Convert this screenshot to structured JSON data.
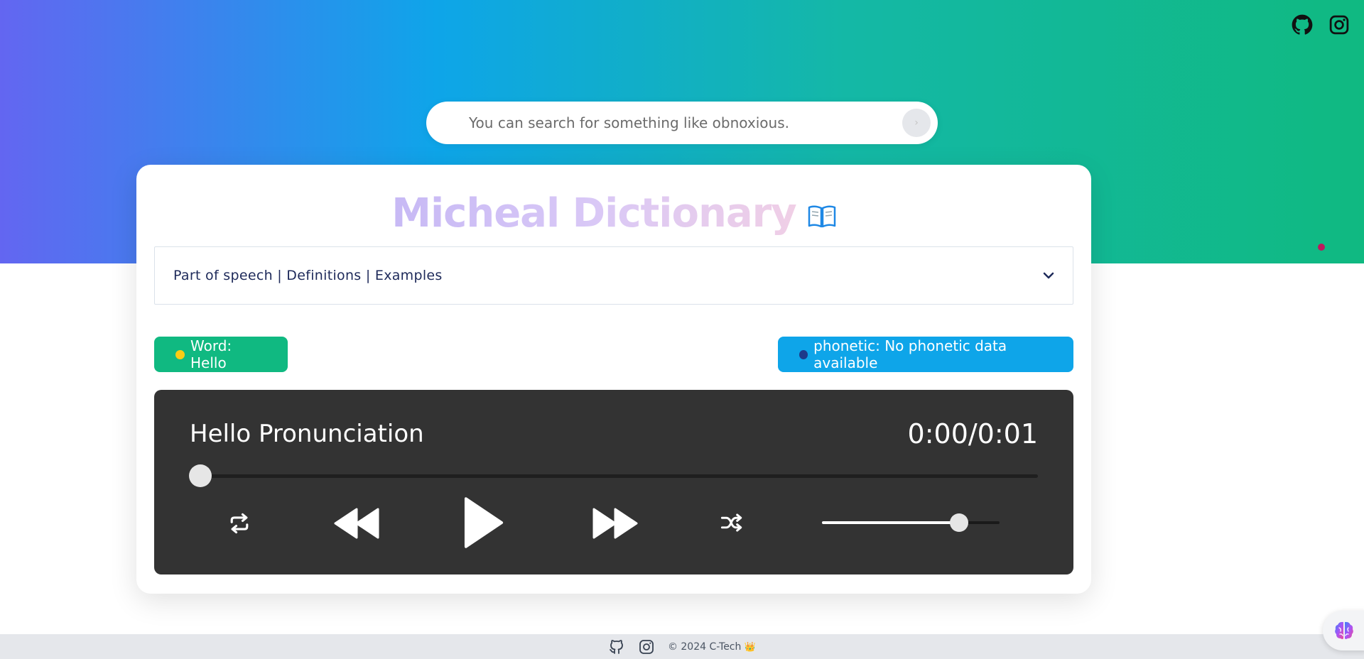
{
  "search": {
    "placeholder": "You can search for something like obnoxious.",
    "button_glyph": "›"
  },
  "header": {
    "title": "Micheal Dictionary",
    "title_icon": "open-book-icon",
    "social_icons": [
      "github-icon",
      "instagram-icon"
    ]
  },
  "accordion": {
    "label": "Part of speech | Definitions | Examples",
    "icon": "chevron-down-icon"
  },
  "badges": {
    "word": "Word: Hello",
    "phonetic": "phonetic: No phonetic data available"
  },
  "player": {
    "title": "Hello Pronunciation",
    "time": "0:00/0:01",
    "progress_fraction": 0.0,
    "volume_fraction": 0.77,
    "controls": [
      "repeat-icon",
      "rewind-icon",
      "play-icon",
      "fast-forward-icon",
      "shuffle-icon"
    ]
  },
  "footer": {
    "text": "© 2024 C-Tech",
    "crown": "👑",
    "icons": [
      "github-icon",
      "instagram-icon"
    ]
  },
  "colors": {
    "gradient_start": "#6366f1",
    "gradient_mid": "#0ea5e9",
    "gradient_end": "#10b981",
    "word_badge": "#10b981",
    "phonetic_badge": "#0ea5e9",
    "player_bg": "#333333"
  }
}
